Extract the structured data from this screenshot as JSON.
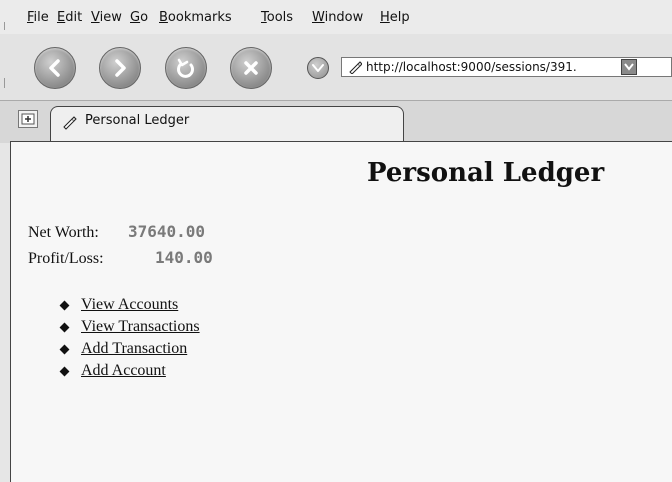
{
  "menu": {
    "items": [
      {
        "mnemonic": "F",
        "rest": "ile"
      },
      {
        "mnemonic": "E",
        "rest": "dit"
      },
      {
        "mnemonic": "V",
        "rest": "iew"
      },
      {
        "mnemonic": "G",
        "rest": "o"
      },
      {
        "mnemonic": "B",
        "rest": "ookmarks"
      },
      {
        "mnemonic": "T",
        "rest": "ools"
      },
      {
        "mnemonic": "W",
        "rest": "indow"
      },
      {
        "mnemonic": "H",
        "rest": "elp"
      }
    ]
  },
  "toolbar": {
    "url": "http://localhost:9000/sessions/391.",
    "icons": [
      "back-icon",
      "forward-icon",
      "reload-icon",
      "stop-icon",
      "home-icon",
      "url-dropdown-icon"
    ]
  },
  "tab": {
    "label": "Personal Ledger"
  },
  "page": {
    "title": "Personal Ledger",
    "net_worth_label": "Net Worth:",
    "net_worth_value": "37640.00",
    "profit_loss_label": "Profit/Loss:",
    "profit_loss_value": "140.00",
    "links": [
      "View Accounts",
      "View Transactions",
      "Add Transaction",
      "Add Account"
    ]
  }
}
